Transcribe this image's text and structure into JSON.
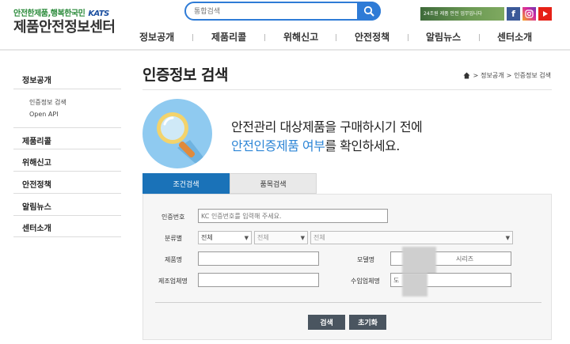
{
  "header": {
    "tagline": "안전한제품,행복한국민",
    "tagline_brand": "KATS",
    "site_title": "제품안전정보센터",
    "search": {
      "placeholder": "통합검색"
    },
    "banner_text": "24조원 제품 안전 업무입니다",
    "social": [
      "f",
      "instagram-icon",
      "youtube-icon"
    ]
  },
  "gnb": [
    "정보공개",
    "제품리콜",
    "위해신고",
    "안전정책",
    "알림뉴스",
    "센터소개"
  ],
  "lnb": {
    "items": [
      "정보공개",
      "제품리콜",
      "위해신고",
      "안전정책",
      "알림뉴스",
      "센터소개"
    ],
    "sub_items": [
      "인증정보 검색",
      "Open API"
    ]
  },
  "page": {
    "title": "인증정보 검색",
    "breadcrumb": [
      "정보공개",
      "인증정보 검색"
    ],
    "breadcrumb_sep": ">",
    "hero_line1": "안전관리 대상제품을 구매하시기 전에",
    "hero_line2_highlight": "안전인증제품 여부",
    "hero_line2_rest": "를 확인하세요."
  },
  "tabs": [
    "조건검색",
    "품목검색"
  ],
  "form": {
    "cert_no_label": "인증번호",
    "cert_no_placeholder": "KC 인증번호를 입력해 주세요.",
    "category_label": "분류별",
    "category_options": [
      "전체",
      "전체",
      "전체"
    ],
    "product_name_label": "제품명",
    "model_name_label": "모델명",
    "model_name_value_suffix": "시리즈",
    "manufacturer_label": "제조업체명",
    "importer_label": "수입업체명",
    "importer_value_prefix": "도",
    "search_button": "검색",
    "reset_button": "초기화"
  },
  "colors": {
    "accent": "#2e7bd6",
    "tab_active": "#1a72b8",
    "highlight_text": "#2e86d6",
    "button": "#4a5560"
  }
}
